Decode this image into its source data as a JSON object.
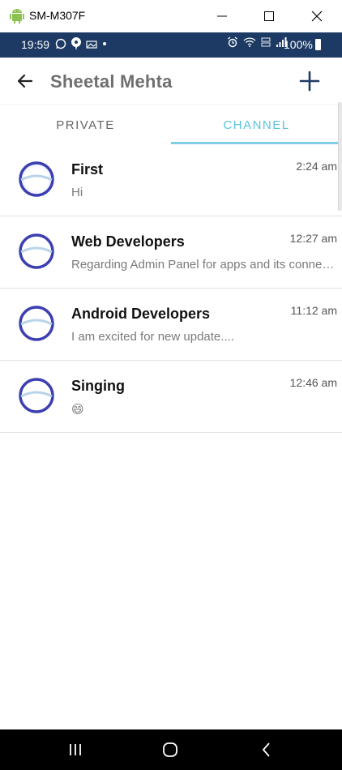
{
  "window": {
    "title": "SM-M307F"
  },
  "status_bar": {
    "time": "19:59",
    "battery": "100%"
  },
  "app_bar": {
    "title": "Sheetal Mehta"
  },
  "tabs": [
    {
      "label": "PRIVATE",
      "selected": false
    },
    {
      "label": "CHANNEL",
      "selected": true
    }
  ],
  "channels": [
    {
      "name": "First",
      "time": "2:24 am",
      "message": "Hi"
    },
    {
      "name": "Web Developers",
      "time": "12:27 am",
      "message": "Regarding Admin Panel for apps and its connection"
    },
    {
      "name": "Android Developers",
      "time": "11:12 am",
      "message": "I am excited for new update...."
    },
    {
      "name": "Singing",
      "time": "12:46 am",
      "message": "😄"
    }
  ],
  "colors": {
    "status_bar": "#1c3a63",
    "tab_active": "#5bc2dd",
    "avatar_ring": "#3b3fb0"
  },
  "icons": {
    "back": "arrow-left-icon",
    "add": "plus-icon",
    "avatar": "channel-avatar-icon"
  }
}
